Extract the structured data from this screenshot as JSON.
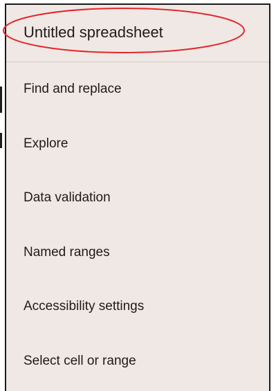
{
  "menu": {
    "title": "Untitled spreadsheet",
    "title_highlight_color": "#e3262b",
    "items": [
      {
        "label": "Find and replace"
      },
      {
        "label": "Explore"
      },
      {
        "label": "Data validation"
      },
      {
        "label": "Named ranges"
      },
      {
        "label": "Accessibility settings"
      },
      {
        "label": "Select cell or range"
      }
    ]
  }
}
